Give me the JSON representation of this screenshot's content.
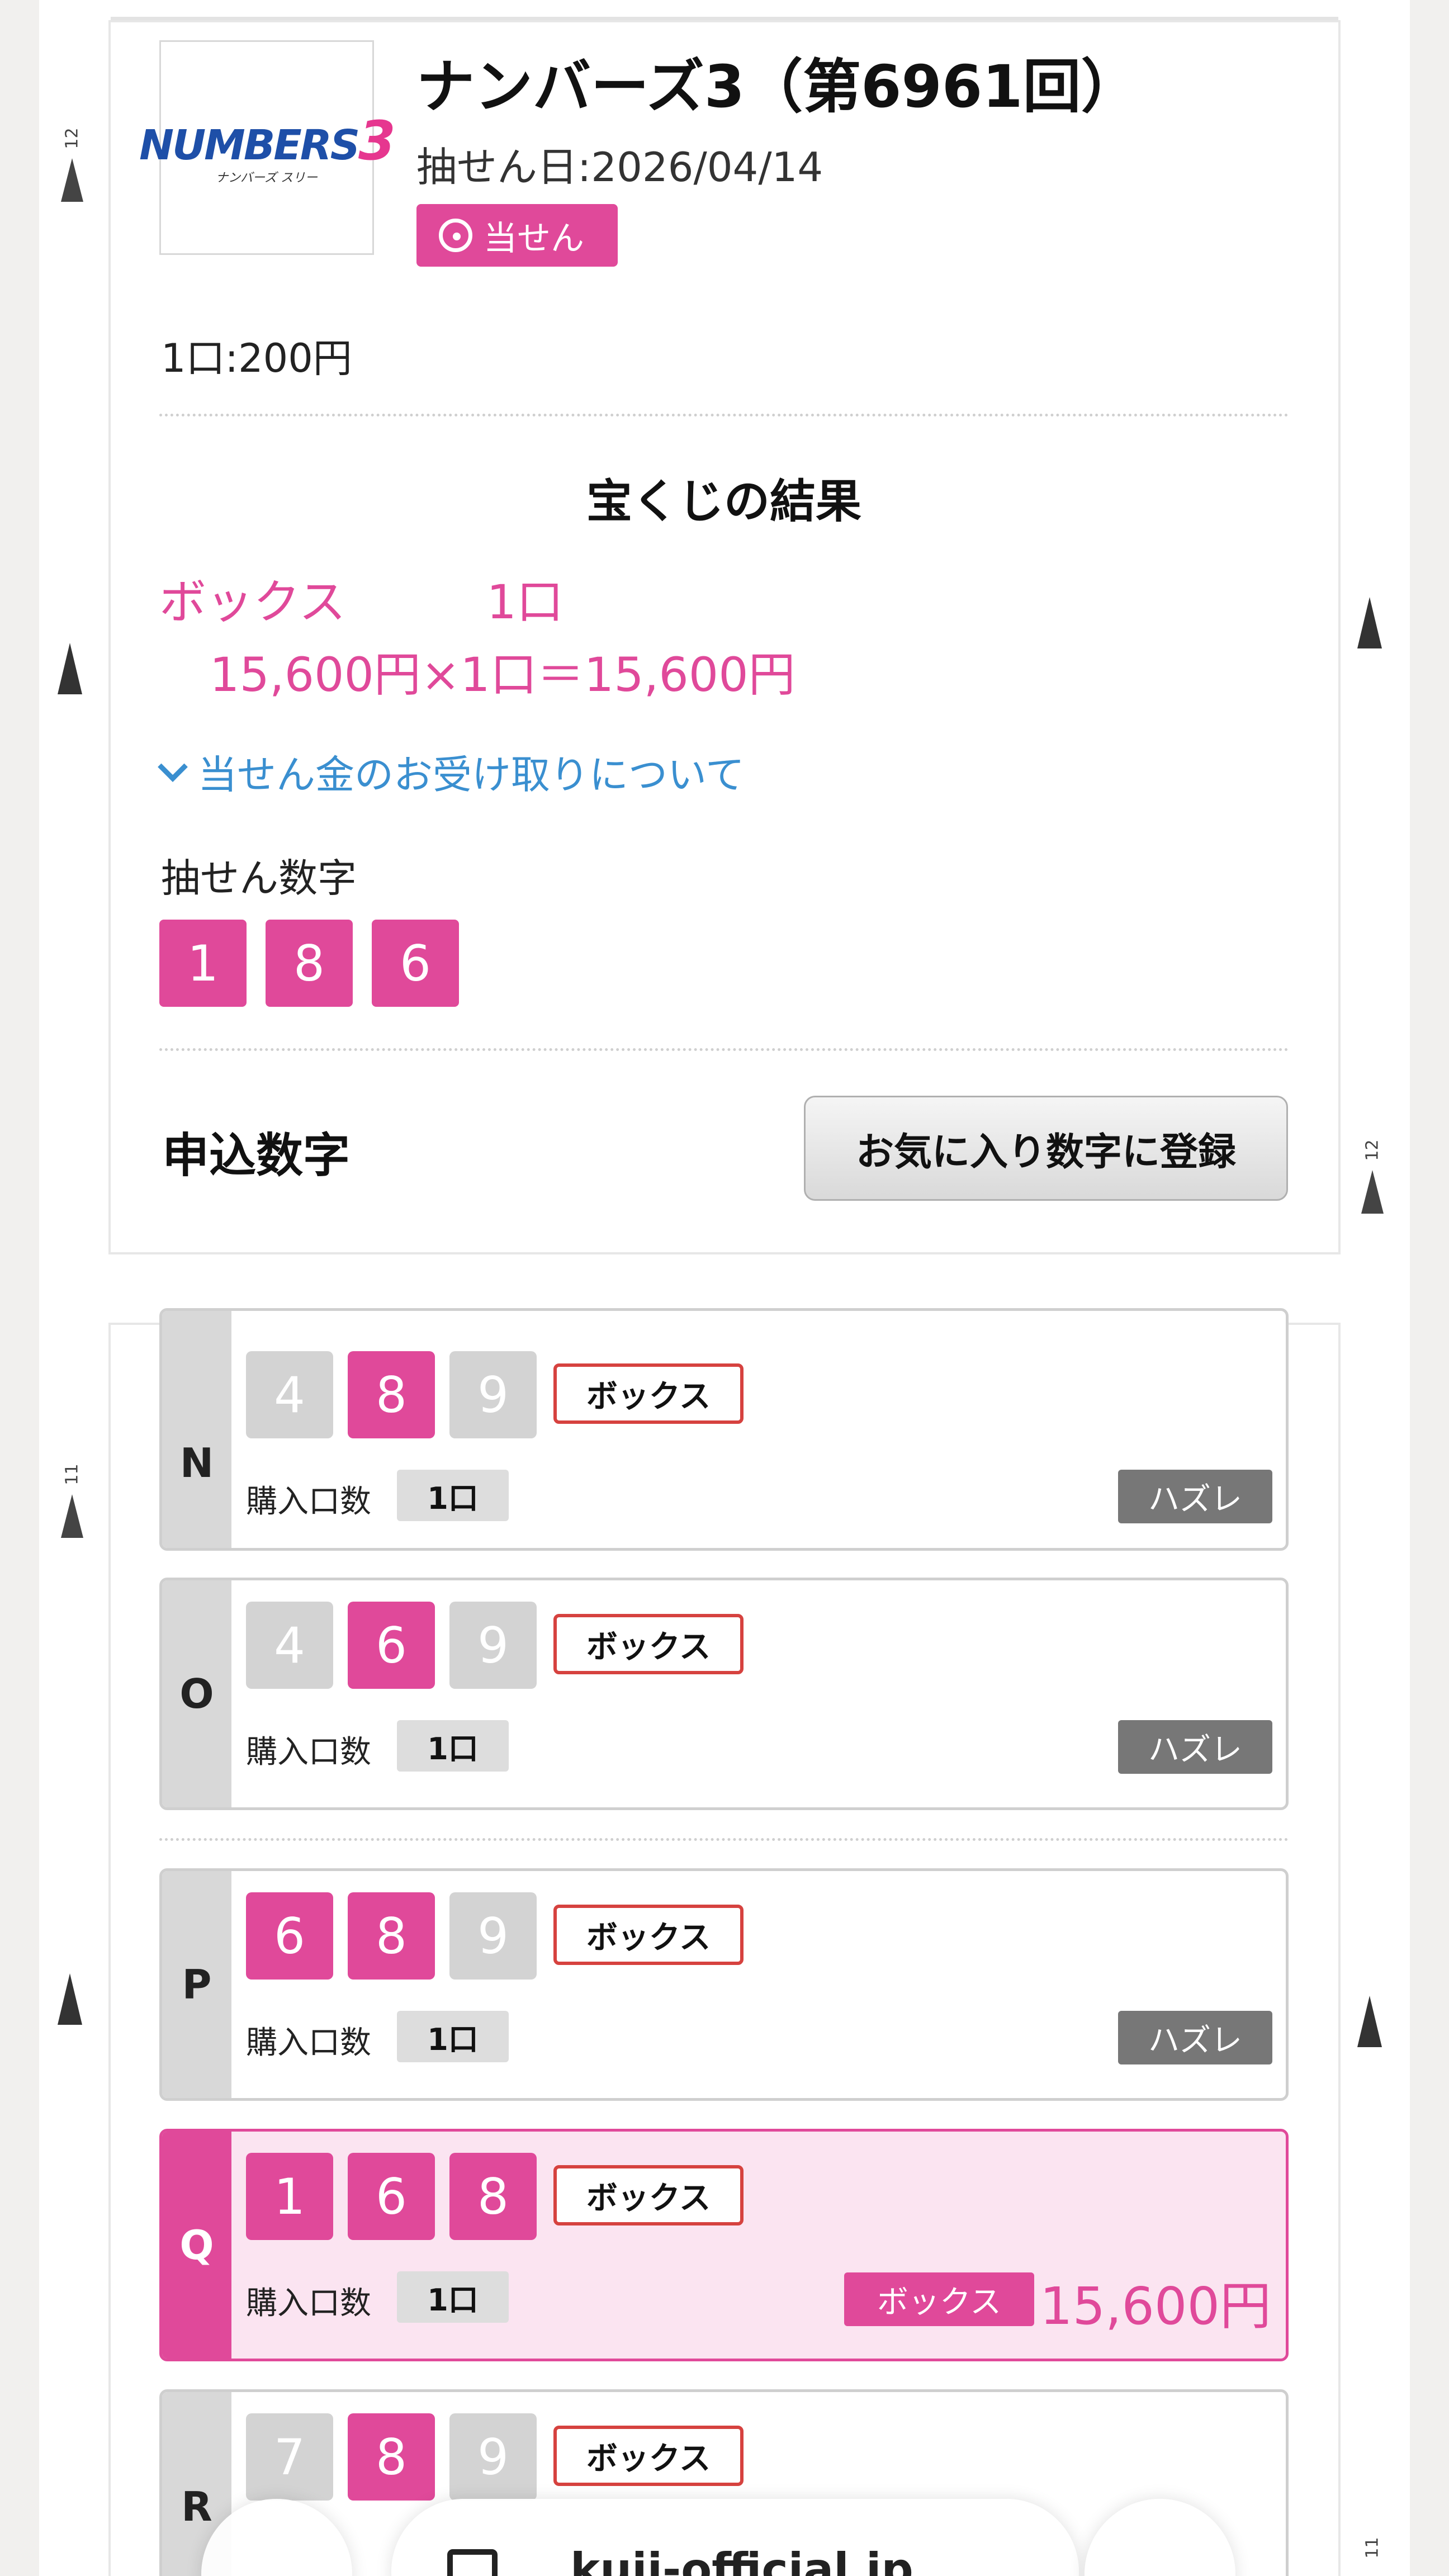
{
  "header": {
    "title": "ナンバーズ3（第6961回）",
    "draw_date": "抽せん日:2026/04/14",
    "win_badge": "当せん",
    "logo_text": "NUMBERS3",
    "logo_sub": "ナンバーズ スリー"
  },
  "price": "1口:200円",
  "result": {
    "heading": "宝くじの結果",
    "prize_line": "ボックス　　　1口",
    "calc_line": "15,600円×1口＝15,600円",
    "receive_link": "当せん金のお受け取りについて"
  },
  "winning": {
    "label": "抽せん数字",
    "digits": [
      "1",
      "8",
      "6"
    ]
  },
  "apply": {
    "label": "申込数字",
    "fav_button": "お気に入り数字に登録"
  },
  "entries": [
    {
      "letter": "N",
      "digits": [
        "4",
        "8",
        "9"
      ],
      "hit": [
        false,
        true,
        false
      ],
      "type": "ボックス",
      "qty_label": "購入口数",
      "qty": "1口",
      "result": "ハズレ"
    },
    {
      "letter": "O",
      "digits": [
        "4",
        "6",
        "9"
      ],
      "hit": [
        false,
        true,
        false
      ],
      "type": "ボックス",
      "qty_label": "購入口数",
      "qty": "1口",
      "result": "ハズレ"
    },
    {
      "letter": "P",
      "digits": [
        "6",
        "8",
        "9"
      ],
      "hit": [
        true,
        true,
        false
      ],
      "type": "ボックス",
      "qty_label": "購入口数",
      "qty": "1口",
      "result": "ハズレ"
    },
    {
      "letter": "Q",
      "digits": [
        "1",
        "6",
        "8"
      ],
      "hit": [
        true,
        true,
        true
      ],
      "type": "ボックス",
      "qty_label": "購入口数",
      "qty": "1口",
      "result_kind": "ボックス",
      "amount": "15,600円"
    },
    {
      "letter": "R",
      "digits": [
        "7",
        "8",
        "9"
      ],
      "hit": [
        false,
        true,
        false
      ],
      "type": "ボックス"
    }
  ],
  "browser": {
    "url": "kuji-official.jp"
  },
  "edge_marks": {
    "top": "12",
    "mid": "11",
    "bottom": "11"
  },
  "colors": {
    "accent": "#e0499a",
    "link": "#3a8fd0",
    "miss": "#777777",
    "type_border": "#d6423f"
  }
}
